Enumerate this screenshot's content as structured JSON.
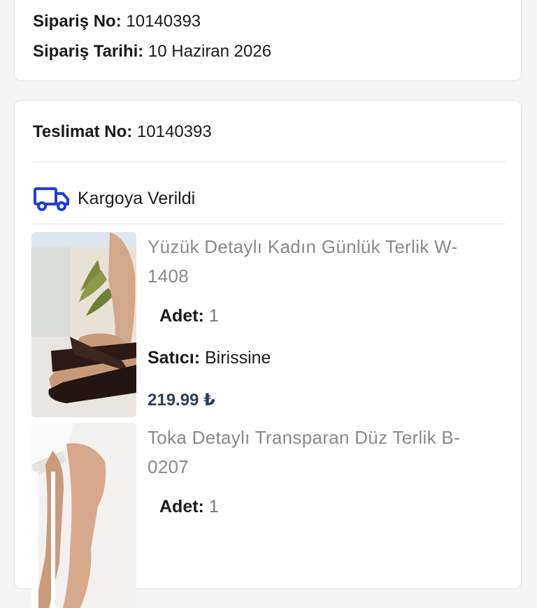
{
  "order": {
    "order_no_label": "Sipariş No:",
    "order_no_value": "10140393",
    "order_date_label": "Sipariş Tarihi:",
    "order_date_value": "10 Haziran 2026"
  },
  "delivery": {
    "delivery_no_label": "Teslimat No:",
    "delivery_no_value": "10140393",
    "status_text": "Kargoya Verildi",
    "status_icon": "truck-icon",
    "accent_color": "#1f3fd6",
    "items": [
      {
        "title": "Yüzük Detaylı Kadın Günlük Terlik W-1408",
        "qty_label": "Adet:",
        "qty_value": "1",
        "seller_label": "Satıcı:",
        "seller_value": "Birissine",
        "price": "219.99 ₺"
      },
      {
        "title": "Toka Detaylı Transparan Düz Terlik B-0207",
        "qty_label": "Adet:",
        "qty_value": "1"
      }
    ]
  }
}
